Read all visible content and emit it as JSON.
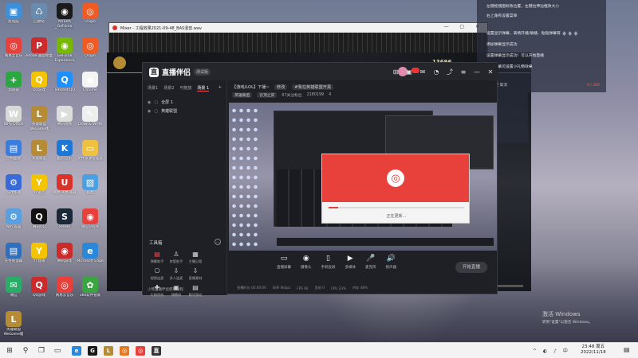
{
  "desktop": {
    "icons": [
      {
        "label": "此电脑",
        "color": "#3d8fd9",
        "glyph": "▣"
      },
      {
        "label": "回收站",
        "color": "#6a8bb0",
        "glyph": "♺"
      },
      {
        "label": "NVIDIA GeForce Experience",
        "color": "#1a1a1a",
        "glyph": "◉"
      },
      {
        "label": "Origin",
        "color": "#f15a22",
        "glyph": "◎"
      },
      {
        "label": "网易云音乐",
        "color": "#e8413b",
        "glyph": "◎"
      },
      {
        "label": "Adobe 画面修复",
        "color": "#cc2b2b",
        "glyph": "P"
      },
      {
        "label": "GeForce Experience",
        "color": "#76b900",
        "glyph": "◉"
      },
      {
        "label": "Origin",
        "color": "#f15a22",
        "glyph": "◎"
      },
      {
        "label": "加速器",
        "color": "#2ba640",
        "glyph": "+"
      },
      {
        "label": "QQ游戏",
        "color": "#f5c400",
        "glyph": "Q"
      },
      {
        "label": "Tencent QQ",
        "color": "#1e90ff",
        "glyph": "Q"
      },
      {
        "label": "Chrome",
        "color": "#f4f4f4",
        "glyph": "◉"
      },
      {
        "label": "WPS Office",
        "color": "#d8d8d8",
        "glyph": "W"
      },
      {
        "label": "英雄联盟 WeGame版",
        "color": "#b68b35",
        "glyph": "L"
      },
      {
        "label": "腾讯视频",
        "color": "#ddd",
        "glyph": "▶"
      },
      {
        "label": "Draw & Write",
        "color": "#eee",
        "glyph": "✎"
      },
      {
        "label": "控制面板",
        "color": "#3b7ddd",
        "glyph": "▤"
      },
      {
        "label": "英雄联盟",
        "color": "#b68b35",
        "glyph": "L"
      },
      {
        "label": "酷狗音乐",
        "color": "#1b78d6",
        "glyph": "K"
      },
      {
        "label": "文件资源管理器",
        "color": "#f0c040",
        "glyph": "▭"
      },
      {
        "label": "游戏加速",
        "color": "#3a6ad8",
        "glyph": "⚙"
      },
      {
        "label": "YY语音",
        "color": "#f5c400",
        "glyph": "Y"
      },
      {
        "label": "网易UU加速器",
        "color": "#d8342c",
        "glyph": "U"
      },
      {
        "label": "画图",
        "color": "#4aa0e0",
        "glyph": "▧"
      },
      {
        "label": "Win 设置",
        "color": "#5aa0e0",
        "glyph": "⚙"
      },
      {
        "label": "腾讯QQ",
        "color": "#111",
        "glyph": "Q"
      },
      {
        "label": "Steam",
        "color": "#1b2838",
        "glyph": "S"
      },
      {
        "label": "微信小程序",
        "color": "#e8413b",
        "glyph": "◉"
      },
      {
        "label": "任务管理器",
        "color": "#2f6fbd",
        "glyph": "▤"
      },
      {
        "label": "YY直播",
        "color": "#f5c400",
        "glyph": "Y"
      },
      {
        "label": "腾讯游戏",
        "color": "#cc2b2b",
        "glyph": "◉"
      },
      {
        "label": "Microsoft Edge",
        "color": "#2b88d8",
        "glyph": "e"
      },
      {
        "label": "微信",
        "color": "#2aae67",
        "glyph": "✉"
      },
      {
        "label": "QQ游戏",
        "color": "#cc2b2b",
        "glyph": "Q"
      },
      {
        "label": "网易云音乐",
        "color": "#e8413b",
        "glyph": "◎"
      },
      {
        "label": "360软件管家",
        "color": "#3aa640",
        "glyph": "✿"
      },
      {
        "label": "英雄联盟 WeGame版",
        "color": "#b68b35",
        "glyph": "L"
      }
    ]
  },
  "back_window": {
    "title": "Mixer - 工程效果2021-09-48_BAS混音.wav"
  },
  "game_bar": {
    "score": "13696"
  },
  "notifications": {
    "lines": [
      "左键拖拽图标改位置，左键拉伸边框改大小",
      "右上角有设置菜单",
      "设置显示弹幕、表情开播/填播、粘贴弹幕等",
      "添加弹幕显示成功",
      "设置弹幕显示成功！可以开始直播",
      "一键弹幕可设置小礼物效果"
    ],
    "footer_left": "设置  清空  取消",
    "footer_right": "0 / 300"
  },
  "app": {
    "brand_name": "直播伴侣",
    "brand_version": "测试版",
    "header_icons": [
      "gift-icon",
      "box-icon",
      "mail-icon",
      "bell-icon",
      "share-icon",
      "menu-icon",
      "minimize-icon",
      "close-icon"
    ],
    "scene_tabs": [
      "场景1",
      "场景2",
      "可拖放",
      "场景 1"
    ],
    "scene_add": "+",
    "scenes": [
      "全屏 1",
      "英雄联盟"
    ],
    "room": {
      "title": "【游戏/LOL】下播~",
      "edit": "修改",
      "category": "#我在英雄联盟开黑",
      "tag1": "英雄联盟",
      "tag2": "云顶之弈",
      "fans": "67关注粉丝",
      "views": "2180199",
      "likes": "4"
    },
    "toolbox_title": "工具箱",
    "tools": [
      {
        "label": "弹幕助手",
        "glyph": "▤",
        "red": true
      },
      {
        "label": "房管助手",
        "glyph": "♙",
        "red": false
      },
      {
        "label": "主播日程",
        "glyph": "▦",
        "red": false
      },
      {
        "label": "",
        "glyph": "",
        "red": false
      },
      {
        "label": "视频连麦",
        "glyph": "⎔",
        "red": false
      },
      {
        "label": "多人连麦",
        "glyph": "⇩",
        "red": false
      },
      {
        "label": "直播素材",
        "glyph": "⇩",
        "red": false
      },
      {
        "label": "",
        "glyph": "",
        "red": false
      },
      {
        "label": "礼物特效",
        "glyph": "✚",
        "red": false
      },
      {
        "label": "弹幕姬",
        "glyph": "▣",
        "red": false
      },
      {
        "label": "歌词滚动",
        "glyph": "▤",
        "red": false
      },
      {
        "label": "",
        "glyph": "",
        "red": false
      }
    ],
    "footer_text": "小熊直播伴侣使用教程",
    "dialog": {
      "status": "正在更新...",
      "progress": 0.07
    },
    "bottom_tools": [
      {
        "label": "直播屏幕",
        "glyph": "▭"
      },
      {
        "label": "摄像头",
        "glyph": "◉"
      },
      {
        "label": "手机投屏",
        "glyph": "▯"
      },
      {
        "label": "多媒体",
        "glyph": "▶"
      },
      {
        "label": "麦克风",
        "glyph": "🎤"
      },
      {
        "label": "扬声器",
        "glyph": "🔊"
      }
    ],
    "start_live": "开始直播",
    "status_items": [
      "直播时长 00:00:00",
      "码率 0kbps",
      "FPS 60",
      "丢帧 0",
      "CPU 23%",
      "内存 48%"
    ]
  },
  "activate_windows": {
    "title": "激活 Windows",
    "subtitle": "转到\"设置\"以激活 Windows。"
  },
  "taskbar": {
    "time": "23:48 周五",
    "date": "2022/11/18"
  }
}
